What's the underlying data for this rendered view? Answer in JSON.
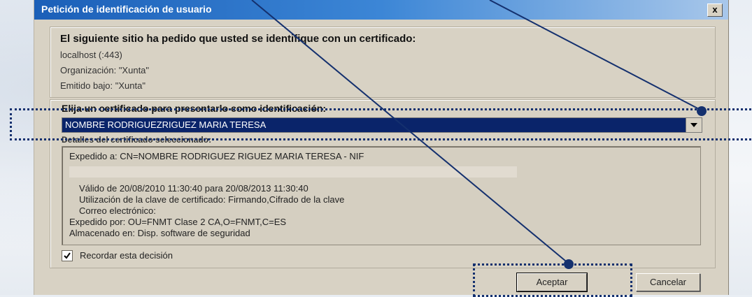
{
  "dialog": {
    "title": "Petición de identificación de usuario",
    "close_label": "x"
  },
  "site_info": {
    "heading": "El siguiente sitio ha pedido que usted se identifique con un certificado:",
    "host": "localhost (:443)",
    "organization": "Organización: \"Xunta\"",
    "issued_under": "Emitido bajo: \"Xunta\""
  },
  "certificate": {
    "heading": "Elija un certificado para presentarlo como identificación:",
    "selected": "NOMBRE RODRIGUEZRIGUEZ MARIA TERESA",
    "details_label": "Detalles del certificado seleccionado:",
    "details": {
      "issued_to": "Expedido a: CN=NOMBRE RODRIGUEZ RIGUEZ MARIA TERESA - NIF",
      "valid": "Válido de 20/08/2010 11:30:40 para 20/08/2013 11:30:40",
      "key_usage": "Utilización de la clave de certificado: Firmando,Cifrado de la clave",
      "email": "Correo electrónico:",
      "issued_by": "Expedido por: OU=FNMT Clase 2 CA,O=FNMT,C=ES",
      "stored_in": "Almacenado en: Disp. software de seguridad"
    }
  },
  "remember": {
    "label": "Recordar esta decisión",
    "checked": true
  },
  "buttons": {
    "accept": "Aceptar",
    "cancel": "Cancelar"
  },
  "colors": {
    "annotation": "#14306e",
    "selection": "#0a246a",
    "title_bar": "#1b5fb8"
  }
}
